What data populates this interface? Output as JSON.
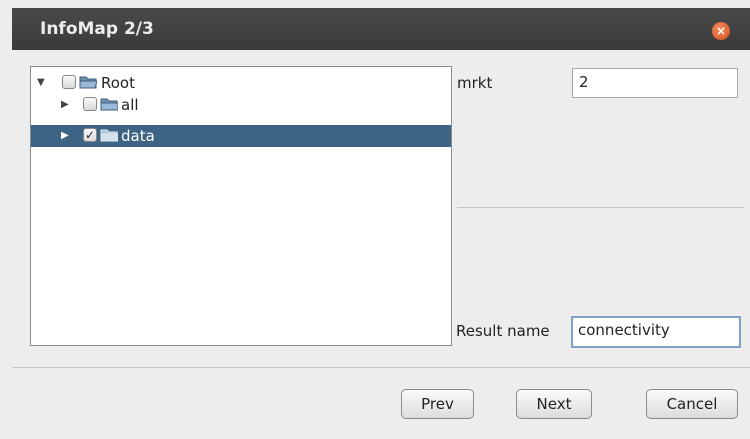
{
  "window": {
    "title": "InfoMap 2/3",
    "close_glyph": "×"
  },
  "tree": {
    "nodes": [
      {
        "label": "Root",
        "expanded": true,
        "checked": false
      },
      {
        "label": "all",
        "expanded": false,
        "checked": false
      },
      {
        "label": "data",
        "expanded": false,
        "checked": true,
        "selected": true
      }
    ],
    "expanded_glyph": "▼",
    "collapsed_glyph": "▶",
    "check_glyph": "✓"
  },
  "params": {
    "mrkt_label": "mrkt",
    "mrkt_value": "2",
    "result_name_label": "Result name",
    "result_name_value": "connectivity"
  },
  "buttons": {
    "prev": "Prev",
    "next": "Next",
    "cancel": "Cancel"
  },
  "colors": {
    "selection": "#3d6385",
    "titlebar": "#3f3f3f",
    "close": "#e06030"
  }
}
